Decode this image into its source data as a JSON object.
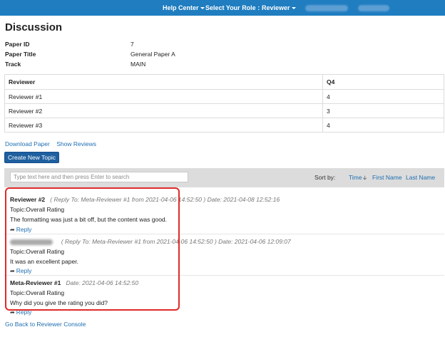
{
  "header": {
    "help_center": "Help Center",
    "select_role": "Select Your Role :",
    "role": "Reviewer"
  },
  "page": {
    "title": "Discussion"
  },
  "paper": {
    "id_label": "Paper ID",
    "id": "7",
    "title_label": "Paper Title",
    "title": "General Paper A",
    "track_label": "Track",
    "track": "MAIN"
  },
  "table": {
    "headers": [
      "Reviewer",
      "Q4"
    ],
    "rows": [
      [
        "Reviewer #1",
        "4"
      ],
      [
        "Reviewer #2",
        "3"
      ],
      [
        "Reviewer #3",
        "4"
      ]
    ]
  },
  "links": {
    "download": "Download Paper",
    "show_reviews": "Show Reviews"
  },
  "create_button": "Create New Topic",
  "search": {
    "placeholder": "Type text here and then press Enter to search"
  },
  "sort": {
    "label": "Sort by:",
    "time": "Time",
    "first_name": "First Name",
    "last_name": "Last Name"
  },
  "posts": [
    {
      "author": "Reviewer #2",
      "reply_to": "( Reply To: Meta-Reviewer #1 from 2021-04-06 14:52:50 )",
      "date": "Date: 2021-04-08 12:52:16",
      "topic": "Topic:Overall Rating",
      "text": "The formatting was just a bit off, but the content was good.",
      "reply": "Reply"
    },
    {
      "author": "",
      "reply_to": "( Reply To: Meta-Reviewer #1 from 2021-04-06 14:52:50 )",
      "date": "Date: 2021-04-06 12:09:07",
      "topic": "Topic:Overall Rating",
      "text": "It was an excellent paper.",
      "reply": "Reply"
    },
    {
      "author": "Meta-Reviewer #1",
      "reply_to": "",
      "date": "Date: 2021-04-06 14:52:50",
      "topic": "Topic:Overall Rating",
      "text": "Why did you give the rating you did?",
      "reply": "Reply"
    }
  ],
  "back_link": "Go Back to Reviewer Console",
  "colors": {
    "topbar": "#1f7dc0",
    "button": "#1e5f9f",
    "link": "#1f6fb2",
    "highlight": "#e02a2a"
  }
}
